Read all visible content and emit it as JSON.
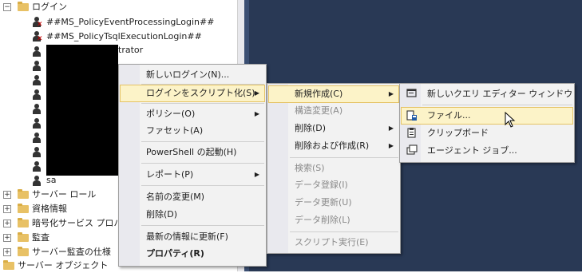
{
  "tree": {
    "logins_folder": "ログイン",
    "login1": "##MS_PolicyEventProcessingLogin##",
    "login2": "##MS_PolicyTsqlExecutionLogin##",
    "login3_partial": "trator",
    "login_sa": "sa",
    "server_roles": "サーバー ロール",
    "credentials": "資格情報",
    "crypto": "暗号化サービス プロバイ",
    "audit": "監査",
    "audit_spec": "サーバー監査の仕様",
    "server_objects": "サーバー オブジェクト"
  },
  "menu1": {
    "new_login": "新しいログイン(N)...",
    "script_login": "ログインをスクリプト化(S)",
    "policy": "ポリシー(O)",
    "facets": "ファセット(A)",
    "powershell": "PowerShell の起動(H)",
    "reports": "レポート(P)",
    "rename": "名前の変更(M)",
    "delete": "削除(D)",
    "refresh": "最新の情報に更新(F)",
    "properties": "プロパティ(R)"
  },
  "menu2": {
    "create": "新規作成(C)",
    "alter": "構造変更(A)",
    "drop": "削除(D)",
    "drop_create": "削除および作成(R)",
    "select": "検索(S)",
    "insert": "データ登録(I)",
    "update": "データ更新(U)",
    "delete_data": "データ削除(L)",
    "execute": "スクリプト実行(E)"
  },
  "menu3": {
    "new_query": "新しいクエリ エディター ウィンドウ",
    "file": "ファイル...",
    "clipboard": "クリップボード",
    "agent_job": "エージェント ジョブ..."
  },
  "colors": {
    "highlight": "#fcf3c8",
    "highlight_border": "#e5c365",
    "background_dark": "#293955"
  }
}
